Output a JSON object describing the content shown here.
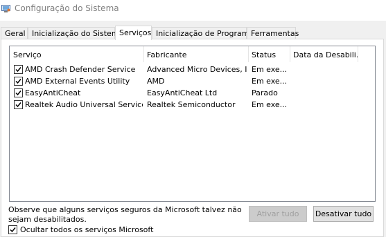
{
  "window": {
    "title": "Configuração do Sistema"
  },
  "tabs": [
    {
      "label": "Geral",
      "active": false
    },
    {
      "label": "Inicialização do Sistema",
      "active": false
    },
    {
      "label": "Serviços",
      "active": true
    },
    {
      "label": "Inicialização de Programas",
      "active": false
    },
    {
      "label": "Ferramentas",
      "active": false
    }
  ],
  "list": {
    "columns": [
      "Serviço",
      "Fabricante",
      "Status",
      "Data da Desabili..."
    ],
    "rows": [
      {
        "checked": true,
        "service": "AMD Crash Defender Service",
        "manufacturer": "Advanced Micro Devices, I...",
        "status": "Em exe..."
      },
      {
        "checked": true,
        "service": "AMD External Events Utility",
        "manufacturer": "AMD",
        "status": "Em exe..."
      },
      {
        "checked": true,
        "service": "EasyAntiCheat",
        "manufacturer": "EasyAntiCheat Ltd",
        "status": "Parado"
      },
      {
        "checked": true,
        "service": "Realtek Audio Universal Service",
        "manufacturer": "Realtek Semiconductor",
        "status": "Em exe..."
      }
    ]
  },
  "footer": {
    "note": "Observe que alguns serviços seguros da Microsoft talvez não sejam desabilitados.",
    "enable_all": "Ativar tudo",
    "disable_all": "Desativar tudo",
    "hide_ms_label": "Ocultar todos os serviços Microsoft",
    "hide_ms_checked": true
  }
}
